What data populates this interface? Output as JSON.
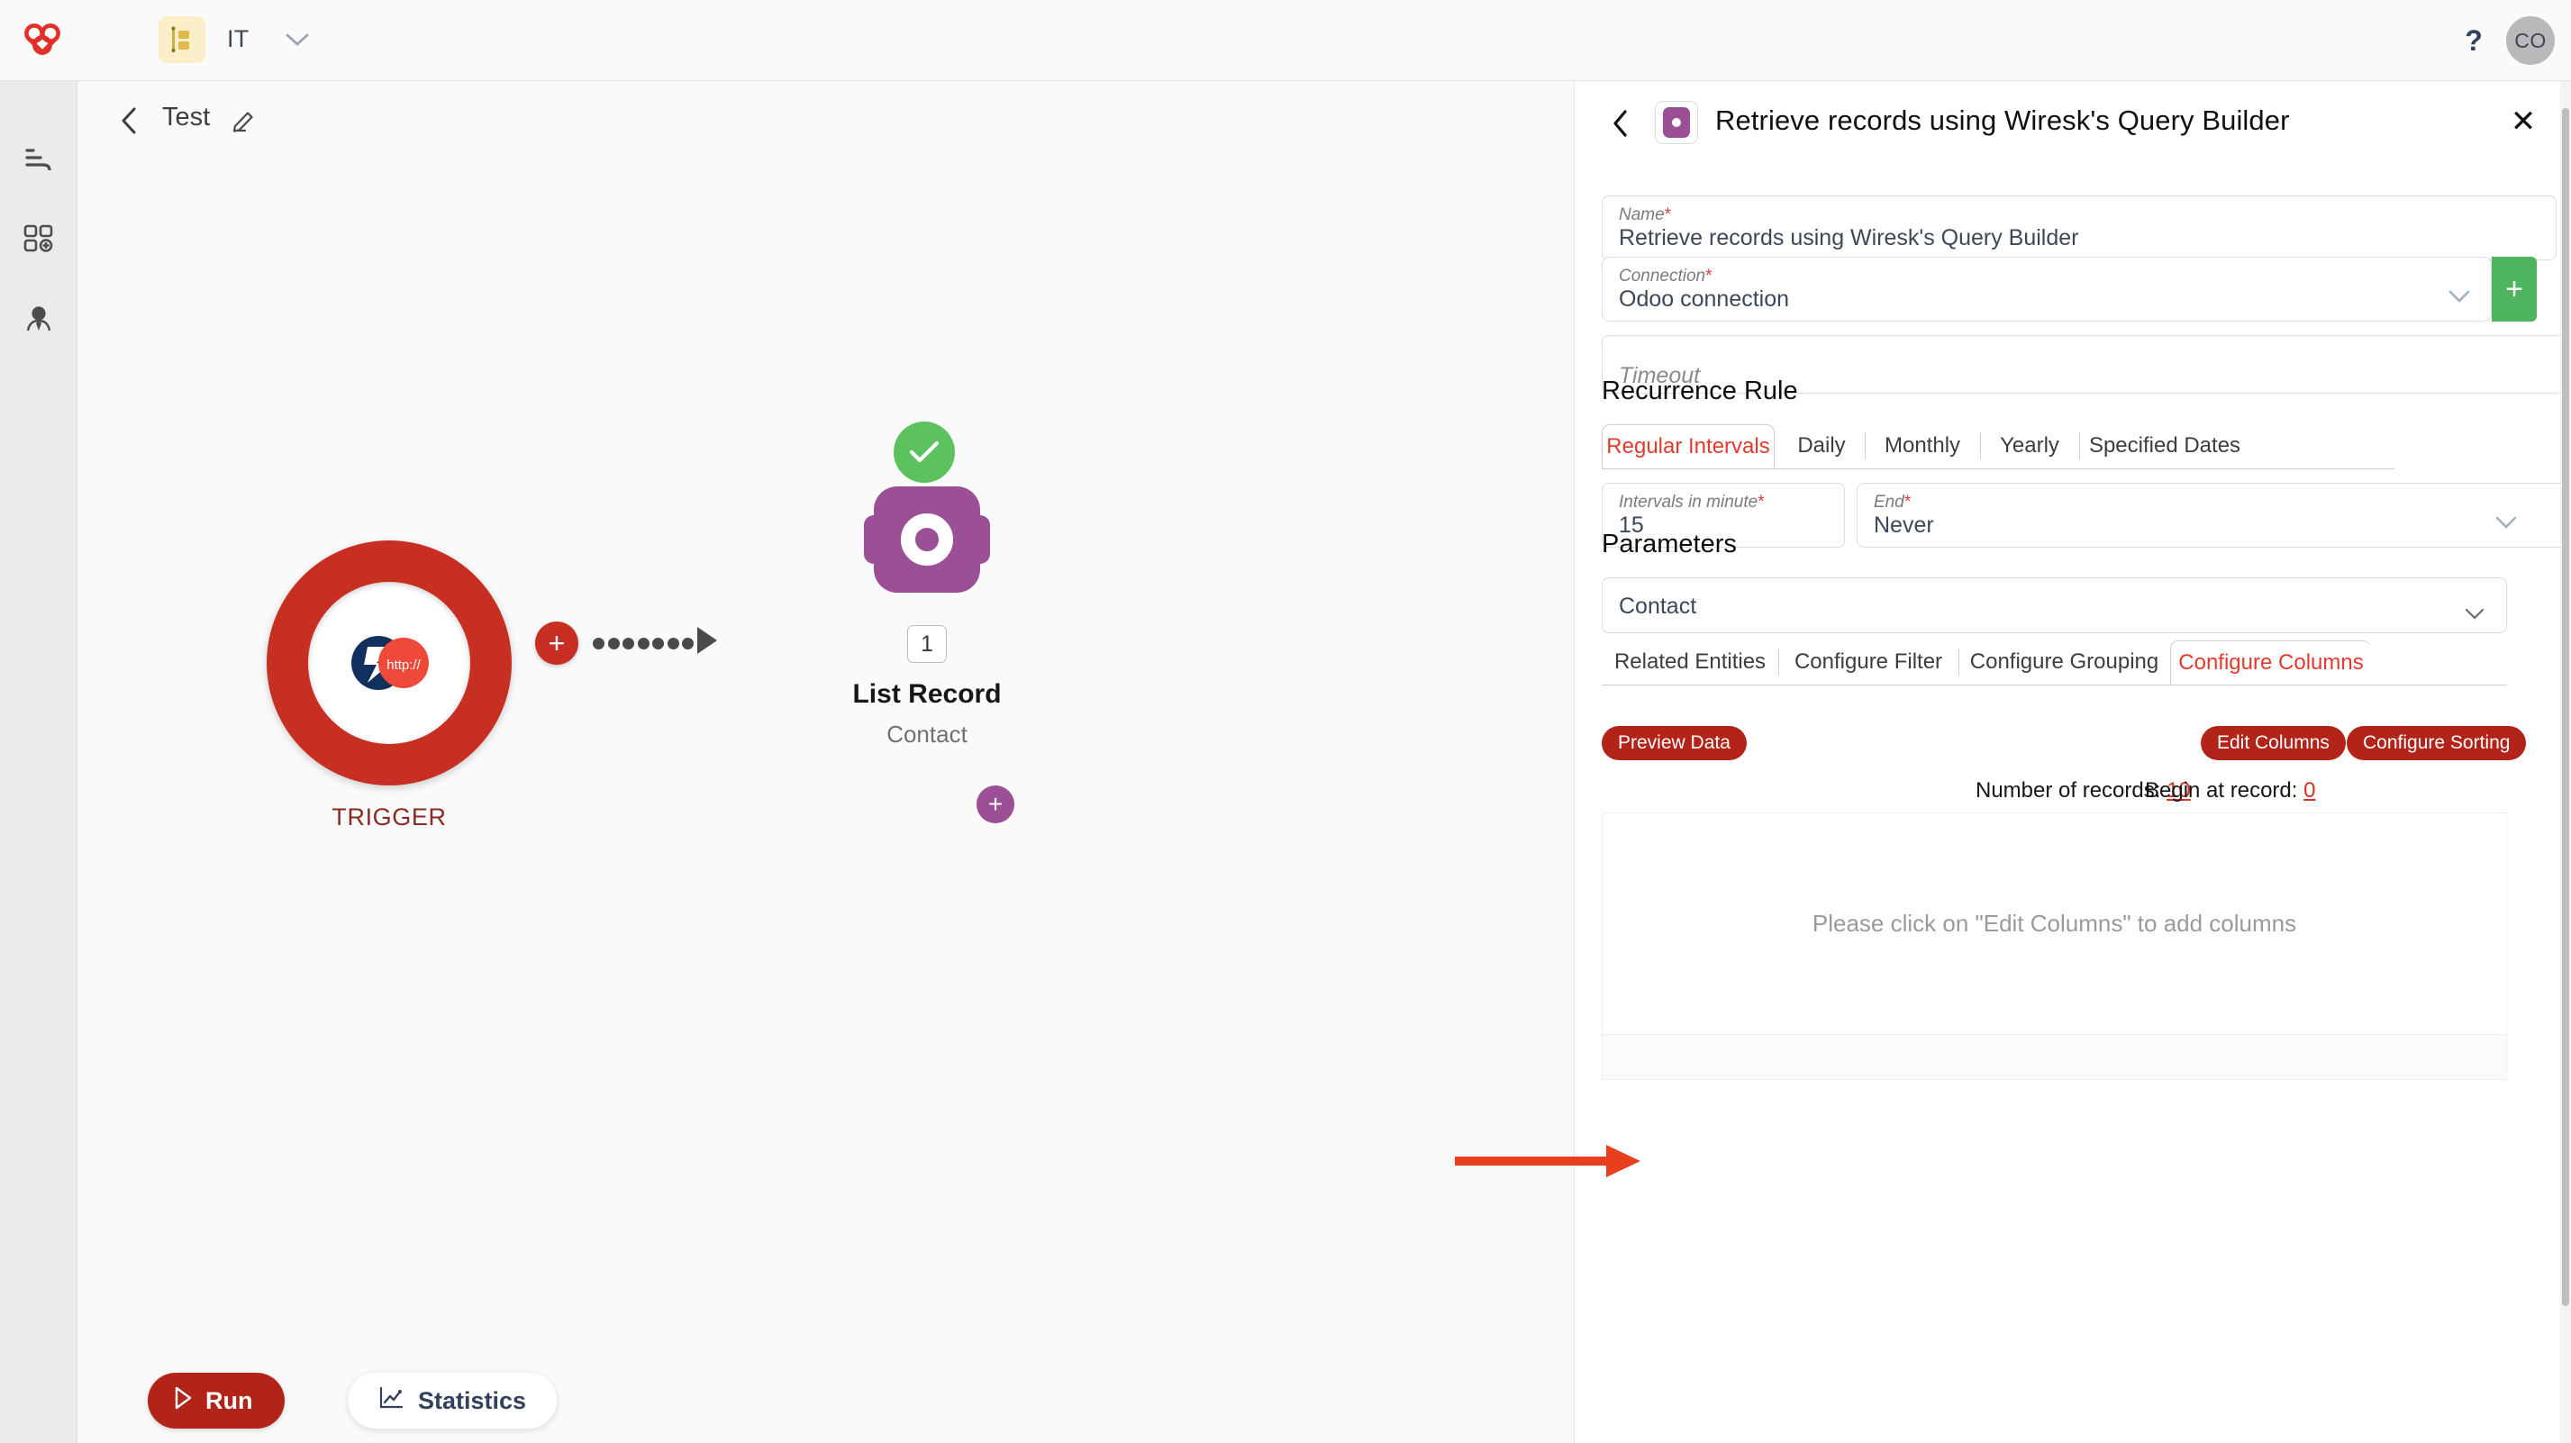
{
  "topbar": {
    "brand_icon": "wiresk-logo-icon",
    "workspace_icon": "workspace-chip-icon",
    "workspace_name": "IT",
    "workspace_caret": "chevron-down-icon",
    "help_label": "?",
    "avatar_initials": "CO"
  },
  "rail": {
    "items": [
      {
        "icon": "workflows-icon",
        "name": "sidebar-item-workflows"
      },
      {
        "icon": "apps-grid-icon",
        "name": "sidebar-item-apps"
      },
      {
        "icon": "user-icon",
        "name": "sidebar-item-user"
      }
    ]
  },
  "canvas": {
    "back_icon": "chevron-left-icon",
    "flow_title": "Test",
    "edit_icon": "pencil-icon",
    "trigger": {
      "label": "TRIGGER",
      "icon": "webhook-http-icon",
      "badge_text": "http://"
    },
    "connector": {
      "add_icon": "plus-icon",
      "dot_count": 7
    },
    "node": {
      "status_icon": "check-icon",
      "app_icon": "odoo-icon",
      "add_icon": "plus-icon",
      "step_number": "1",
      "title": "List Record",
      "subtitle": "Contact"
    },
    "run_button": {
      "label": "Run",
      "icon": "play-icon"
    },
    "statistics_button": {
      "label": "Statistics",
      "icon": "chart-line-icon"
    }
  },
  "panel": {
    "back_icon": "chevron-left-icon",
    "app_icon": "odoo-icon",
    "title": "Retrieve records using Wiresk's Query Builder",
    "close_icon": "close-icon",
    "name_field": {
      "label": "Name",
      "required": "*",
      "value": "Retrieve records using Wiresk's Query Builder"
    },
    "connection_field": {
      "label": "Connection",
      "required": "*",
      "value": "Odoo connection",
      "caret_icon": "chevron-down-icon",
      "add_icon": "plus-icon"
    },
    "timeout_field": {
      "placeholder": "Timeout"
    },
    "recurrence": {
      "heading": "Recurrence Rule",
      "tabs": [
        {
          "label": "Regular Intervals",
          "active": true
        },
        {
          "label": "Daily",
          "active": false
        },
        {
          "label": "Monthly",
          "active": false
        },
        {
          "label": "Yearly",
          "active": false
        },
        {
          "label": "Specified Dates",
          "active": false
        }
      ],
      "interval_field": {
        "label": "Intervals in minute",
        "required": "*",
        "value": "15"
      },
      "end_field": {
        "label": "End",
        "required": "*",
        "value": "Never",
        "caret_icon": "chevron-down-icon"
      }
    },
    "parameters": {
      "heading": "Parameters",
      "entity_select": {
        "value": "Contact",
        "caret_icon": "chevron-down-icon"
      },
      "tabs": [
        {
          "label": "Related Entities",
          "active": false
        },
        {
          "label": "Configure Filter",
          "active": false
        },
        {
          "label": "Configure Grouping",
          "active": false
        },
        {
          "label": "Configure Columns",
          "active": true
        }
      ],
      "preview_button": "Preview Data",
      "edit_columns_button": "Edit Columns",
      "configure_sorting_button": "Configure Sorting",
      "records_label": "Number of records:",
      "records_value": "10",
      "begin_label": "Begin at record:",
      "begin_value": "0",
      "empty_message": "Please click on \"Edit Columns\" to add columns"
    }
  },
  "colors": {
    "brand_red": "#c62f21",
    "accent_red": "#b2241a",
    "active_tab_red": "#e23b2e",
    "node_purple": "#9b4f95",
    "success_green": "#5cc25e",
    "add_green": "#4fb45e",
    "annotation_orange": "#e8401f"
  }
}
